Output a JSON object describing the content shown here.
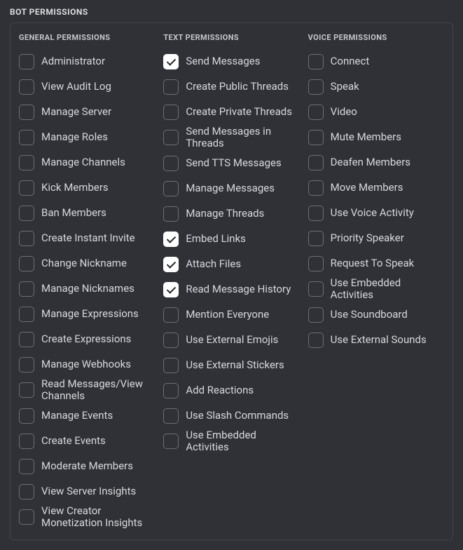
{
  "section_title": "BOT PERMISSIONS",
  "columns": [
    {
      "title": "GENERAL PERMISSIONS",
      "key": "general",
      "items": [
        {
          "label": "Administrator",
          "checked": false,
          "key": "administrator"
        },
        {
          "label": "View Audit Log",
          "checked": false,
          "key": "view-audit-log"
        },
        {
          "label": "Manage Server",
          "checked": false,
          "key": "manage-server"
        },
        {
          "label": "Manage Roles",
          "checked": false,
          "key": "manage-roles"
        },
        {
          "label": "Manage Channels",
          "checked": false,
          "key": "manage-channels"
        },
        {
          "label": "Kick Members",
          "checked": false,
          "key": "kick-members"
        },
        {
          "label": "Ban Members",
          "checked": false,
          "key": "ban-members"
        },
        {
          "label": "Create Instant Invite",
          "checked": false,
          "key": "create-instant-invite"
        },
        {
          "label": "Change Nickname",
          "checked": false,
          "key": "change-nickname"
        },
        {
          "label": "Manage Nicknames",
          "checked": false,
          "key": "manage-nicknames"
        },
        {
          "label": "Manage Expressions",
          "checked": false,
          "key": "manage-expressions"
        },
        {
          "label": "Create Expressions",
          "checked": false,
          "key": "create-expressions"
        },
        {
          "label": "Manage Webhooks",
          "checked": false,
          "key": "manage-webhooks"
        },
        {
          "label": "Read Messages/View Channels",
          "checked": false,
          "key": "read-messages-view-channels"
        },
        {
          "label": "Manage Events",
          "checked": false,
          "key": "manage-events"
        },
        {
          "label": "Create Events",
          "checked": false,
          "key": "create-events"
        },
        {
          "label": "Moderate Members",
          "checked": false,
          "key": "moderate-members"
        },
        {
          "label": "View Server Insights",
          "checked": false,
          "key": "view-server-insights"
        },
        {
          "label": "View Creator Monetization Insights",
          "checked": false,
          "key": "view-creator-monetization-insights"
        }
      ]
    },
    {
      "title": "TEXT PERMISSIONS",
      "key": "text",
      "items": [
        {
          "label": "Send Messages",
          "checked": true,
          "key": "send-messages"
        },
        {
          "label": "Create Public Threads",
          "checked": false,
          "key": "create-public-threads"
        },
        {
          "label": "Create Private Threads",
          "checked": false,
          "key": "create-private-threads"
        },
        {
          "label": "Send Messages in Threads",
          "checked": false,
          "key": "send-messages-in-threads"
        },
        {
          "label": "Send TTS Messages",
          "checked": false,
          "key": "send-tts-messages"
        },
        {
          "label": "Manage Messages",
          "checked": false,
          "key": "manage-messages"
        },
        {
          "label": "Manage Threads",
          "checked": false,
          "key": "manage-threads"
        },
        {
          "label": "Embed Links",
          "checked": true,
          "key": "embed-links"
        },
        {
          "label": "Attach Files",
          "checked": true,
          "key": "attach-files"
        },
        {
          "label": "Read Message History",
          "checked": true,
          "key": "read-message-history"
        },
        {
          "label": "Mention Everyone",
          "checked": false,
          "key": "mention-everyone"
        },
        {
          "label": "Use External Emojis",
          "checked": false,
          "key": "use-external-emojis"
        },
        {
          "label": "Use External Stickers",
          "checked": false,
          "key": "use-external-stickers"
        },
        {
          "label": "Add Reactions",
          "checked": false,
          "key": "add-reactions"
        },
        {
          "label": "Use Slash Commands",
          "checked": false,
          "key": "use-slash-commands"
        },
        {
          "label": "Use Embedded Activities",
          "checked": false,
          "key": "use-embedded-activities-text"
        }
      ]
    },
    {
      "title": "VOICE PERMISSIONS",
      "key": "voice",
      "items": [
        {
          "label": "Connect",
          "checked": false,
          "key": "connect"
        },
        {
          "label": "Speak",
          "checked": false,
          "key": "speak"
        },
        {
          "label": "Video",
          "checked": false,
          "key": "video"
        },
        {
          "label": "Mute Members",
          "checked": false,
          "key": "mute-members"
        },
        {
          "label": "Deafen Members",
          "checked": false,
          "key": "deafen-members"
        },
        {
          "label": "Move Members",
          "checked": false,
          "key": "move-members"
        },
        {
          "label": "Use Voice Activity",
          "checked": false,
          "key": "use-voice-activity"
        },
        {
          "label": "Priority Speaker",
          "checked": false,
          "key": "priority-speaker"
        },
        {
          "label": "Request To Speak",
          "checked": false,
          "key": "request-to-speak"
        },
        {
          "label": "Use Embedded Activities",
          "checked": false,
          "key": "use-embedded-activities-voice"
        },
        {
          "label": "Use Soundboard",
          "checked": false,
          "key": "use-soundboard"
        },
        {
          "label": "Use External Sounds",
          "checked": false,
          "key": "use-external-sounds"
        }
      ]
    }
  ]
}
